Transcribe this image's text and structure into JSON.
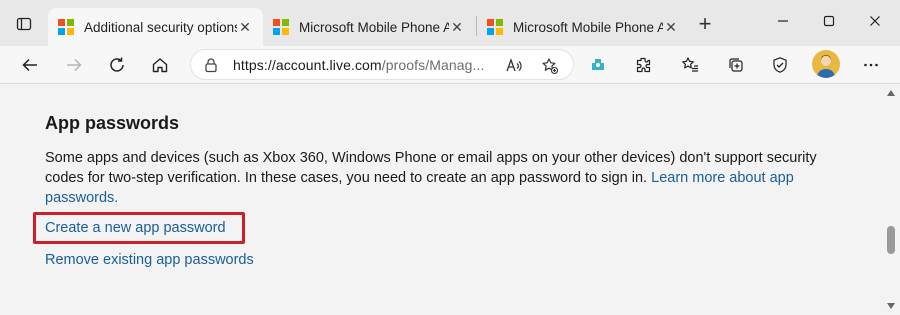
{
  "browser": {
    "tabs": [
      {
        "title": "Additional security options",
        "active": true
      },
      {
        "title": "Microsoft Mobile Phone Au",
        "active": false
      },
      {
        "title": "Microsoft Mobile Phone Au",
        "active": false
      }
    ],
    "address": {
      "host": "https://account.live.com",
      "path": "/proofs/Manag..."
    },
    "extension_badge": "0",
    "colors": {
      "ms_red": "#f25022",
      "ms_green": "#7fba00",
      "ms_blue": "#00a4ef",
      "ms_yellow": "#ffb900",
      "link": "#1a5e9a",
      "highlight": "#cc1f2a"
    }
  },
  "page": {
    "section_title": "App passwords",
    "description": "Some apps and devices (such as Xbox 360, Windows Phone or email apps on your other devices) don't support security codes for two-step verification. In these cases, you need to create an app password to sign in.",
    "learn_more_link": "Learn more about app passwords.",
    "create_link": "Create a new app password",
    "remove_link": "Remove existing app passwords"
  }
}
